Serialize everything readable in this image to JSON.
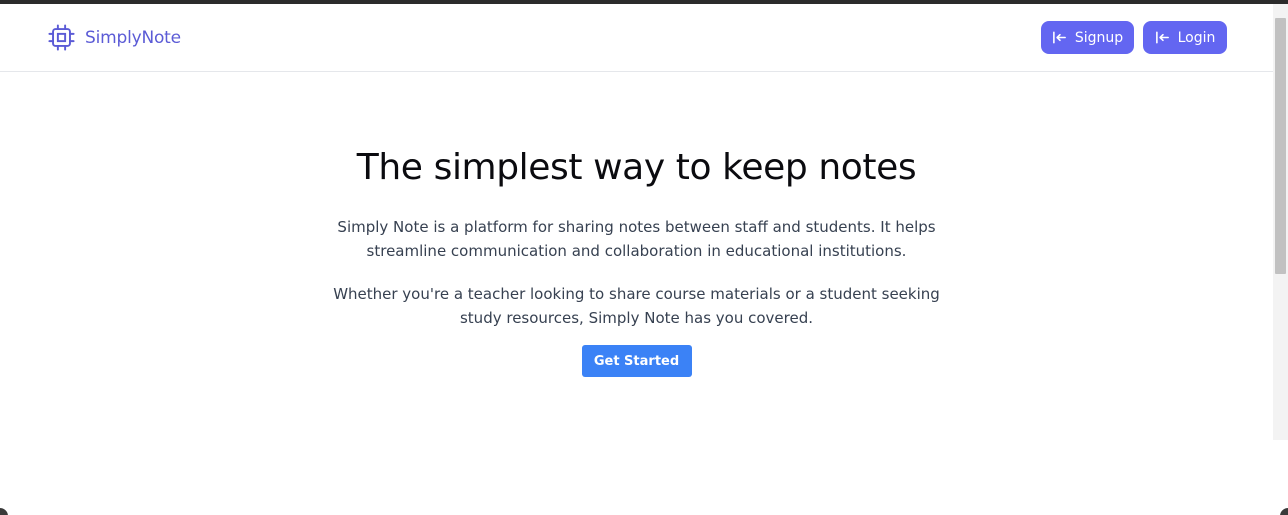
{
  "brand": {
    "name": "SimplyNote",
    "icon": "cpu-chip-icon",
    "color": "#5b5bd6"
  },
  "nav": {
    "signup_label": "Signup",
    "login_label": "Login",
    "button_icon": "arrow-left-to-line-icon",
    "button_color": "#6366f1"
  },
  "hero": {
    "title": "The simplest way to keep notes",
    "paragraph1": "Simply Note is a platform for sharing notes between staff and students. It helps streamline communication and collaboration in educational institutions.",
    "paragraph2": "Whether you're a teacher looking to share course materials or a student seeking study resources, Simply Note has you covered.",
    "cta_label": "Get Started",
    "cta_color": "#3b82f6"
  }
}
